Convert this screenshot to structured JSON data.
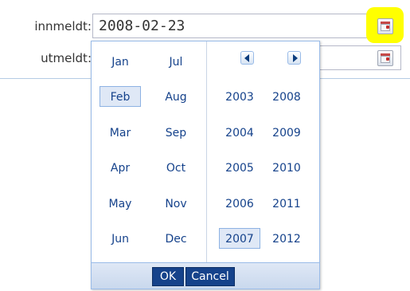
{
  "form": {
    "innmeldt_label": "innmeldt:",
    "innmeldt_value": "2008-02-23",
    "utmeldt_label": "utmeldt:",
    "utmeldt_value": ""
  },
  "picker": {
    "months": [
      "Jan",
      "Feb",
      "Mar",
      "Apr",
      "May",
      "Jun",
      "Jul",
      "Aug",
      "Sep",
      "Oct",
      "Nov",
      "Dec"
    ],
    "selected_month": "Feb",
    "years": [
      "2003",
      "2004",
      "2005",
      "2006",
      "2007",
      "2008",
      "2009",
      "2010",
      "2011",
      "2012"
    ],
    "selected_year": "2007",
    "ok_label": "OK",
    "cancel_label": "Cancel",
    "prev_icon": "triangle-left-icon",
    "next_icon": "triangle-right-icon"
  },
  "colors": {
    "accent": "#15428b",
    "highlight": "#ffff00",
    "selected_bg": "#dfe8f6"
  }
}
